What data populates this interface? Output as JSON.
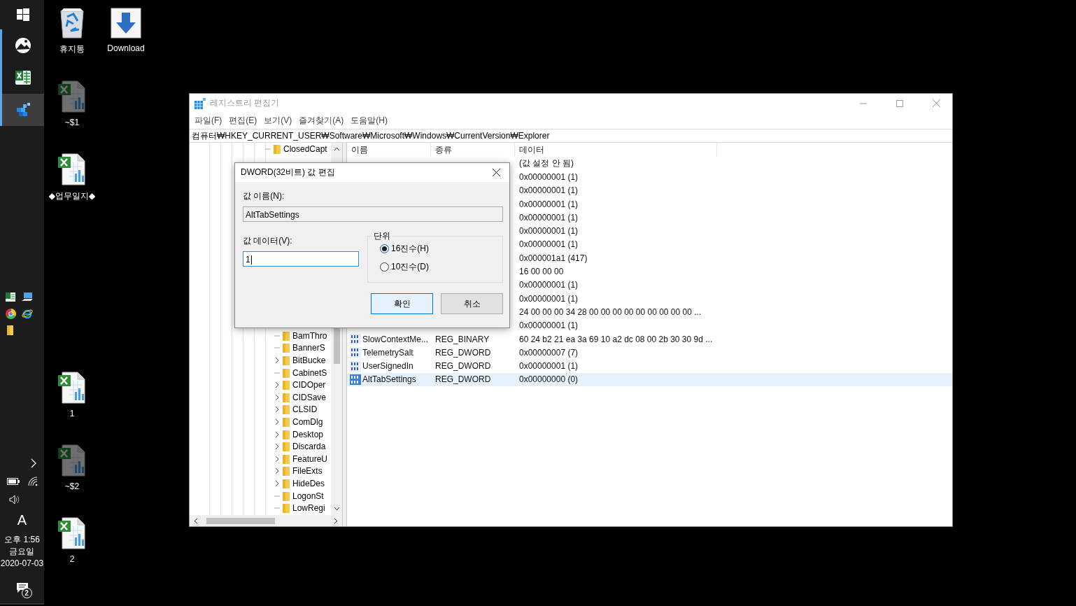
{
  "taskbar": {
    "apps": [
      {
        "kind": "start",
        "running": false,
        "active": false
      },
      {
        "kind": "viewer",
        "running": true,
        "active": false
      },
      {
        "kind": "excel",
        "running": true,
        "active": false
      },
      {
        "kind": "registry",
        "running": true,
        "active": true
      }
    ],
    "quick_launch": [
      {
        "kind": "excel"
      },
      {
        "kind": "computer"
      },
      {
        "kind": "chrome"
      },
      {
        "kind": "ie"
      },
      {
        "kind": "folder"
      }
    ],
    "ime": "A",
    "clock": {
      "time": "오후 1:56",
      "day": "금요일",
      "date": "2020-07-03"
    },
    "notification_count": "2"
  },
  "desktop_icons": [
    {
      "label": "휴지통",
      "kind": "recycle"
    },
    {
      "label": "Download",
      "kind": "download"
    },
    {
      "label": "~$1",
      "kind": "excel",
      "hidden": true
    },
    {
      "label": "◆업무일지◆",
      "kind": "excel",
      "hidden": false
    },
    {
      "label": "1",
      "kind": "excel",
      "hidden": false
    },
    {
      "label": "~$2",
      "kind": "excel",
      "hidden": true
    },
    {
      "label": "2",
      "kind": "excel",
      "hidden": false
    }
  ],
  "window": {
    "title": "레지스트리 편집기",
    "active": false,
    "menu": [
      "파일(F)",
      "편집(E)",
      "보기(V)",
      "즐겨찾기(A)",
      "도움말(H)"
    ],
    "address": "컴퓨터₩HKEY_CURRENT_USER₩Software₩Microsoft₩Windows₩CurrentVersion₩Explorer",
    "tree": {
      "upper": [
        {
          "label": "ClosedCapt",
          "expandable": false
        }
      ],
      "lower": [
        {
          "label": "BamThro",
          "expandable": false
        },
        {
          "label": "BannerS",
          "expandable": false
        },
        {
          "label": "BitBucke",
          "expandable": true
        },
        {
          "label": "CabinetS",
          "expandable": false
        },
        {
          "label": "CIDOper",
          "expandable": true
        },
        {
          "label": "CIDSave",
          "expandable": true
        },
        {
          "label": "CLSID",
          "expandable": true
        },
        {
          "label": "ComDlg",
          "expandable": true
        },
        {
          "label": "Desktop",
          "expandable": true
        },
        {
          "label": "Discarda",
          "expandable": true
        },
        {
          "label": "FeatureU",
          "expandable": true
        },
        {
          "label": "FileExts",
          "expandable": true
        },
        {
          "label": "HideDes",
          "expandable": true
        },
        {
          "label": "LogonSt",
          "expandable": false
        },
        {
          "label": "LowRegi",
          "expandable": false
        }
      ]
    },
    "columns": [
      "이름",
      "종류",
      "데이터"
    ],
    "rows": [
      {
        "data": "(값 설정 안 됨)",
        "selected": false
      },
      {
        "data": "0x00000001 (1)",
        "selected": false
      },
      {
        "data": "0x00000001 (1)",
        "selected": false
      },
      {
        "data": "0x00000001 (1)",
        "selected": false
      },
      {
        "data": "0x00000001 (1)",
        "selected": false
      },
      {
        "data": "0x00000001 (1)",
        "selected": false
      },
      {
        "data": "0x00000001 (1)",
        "selected": false
      },
      {
        "data": "0x000001a1 (417)",
        "selected": false
      },
      {
        "data": "16 00 00 00",
        "selected": false
      },
      {
        "data": "0x00000001 (1)",
        "selected": false
      },
      {
        "data": "0x00000001 (1)",
        "selected": false
      },
      {
        "data": "24 00 00 00 34 28 00 00 00 00 00 00 00 00 00 ...",
        "selected": false
      },
      {
        "data": "0x00000001 (1)",
        "selected": false
      },
      {
        "name": "SlowContextMe...",
        "type": "REG_BINARY",
        "data": "60 24 b2 21 ea 3a 69 10 a2 dc 08 00 2b 30 30 9d ...",
        "selected": false
      },
      {
        "name": "TelemetrySalt",
        "type": "REG_DWORD",
        "data": "0x00000007 (7)",
        "selected": false
      },
      {
        "name": "UserSignedIn",
        "type": "REG_DWORD",
        "data": "0x00000001 (1)",
        "selected": false
      },
      {
        "name": "AltTabSettings",
        "type": "REG_DWORD",
        "data": "0x00000000 (0)",
        "selected": true
      }
    ]
  },
  "dialog": {
    "title": "DWORD(32비트) 값 편집",
    "name_label": "값 이름(N):",
    "name_value": "AltTabSettings",
    "data_label": "값 데이터(V):",
    "data_value": "1",
    "base_label": "단위",
    "bases": [
      {
        "label": "16진수(H)",
        "selected": true
      },
      {
        "label": "10진수(D)",
        "selected": false
      }
    ],
    "buttons": [
      {
        "label": "확인",
        "default": true
      },
      {
        "label": "취소",
        "default": false
      }
    ]
  }
}
